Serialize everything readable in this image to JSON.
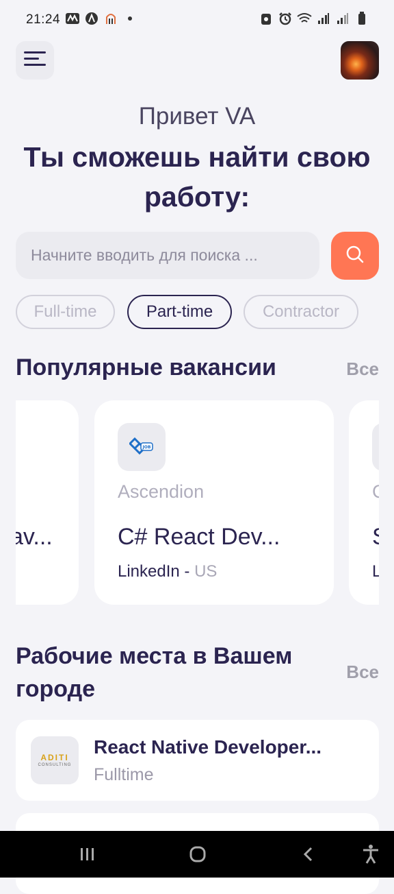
{
  "status": {
    "time": "21:24"
  },
  "header": {
    "menu_icon": "hamburger-icon",
    "avatar": "profile-avatar"
  },
  "greeting": "Привет VA",
  "headline": "Ты сможешь найти свою работу:",
  "search": {
    "placeholder": "Начните вводить для поиска ...",
    "icon": "search-icon",
    "accent": "#ff7654"
  },
  "filters": [
    {
      "label": "Full-time",
      "active": false
    },
    {
      "label": "Part-time",
      "active": true
    },
    {
      "label": "Contractor",
      "active": false
    }
  ],
  "popular": {
    "title": "Популярные вакансии",
    "see_all": "Все",
    "cards": [
      {
        "company": "",
        "title": "av...",
        "source": "",
        "location": ""
      },
      {
        "company": "Ascendion",
        "title": "C# React Dev...",
        "source": "LinkedIn - ",
        "location": "US"
      },
      {
        "company": "C",
        "title": "S",
        "source": "L",
        "location": ""
      }
    ]
  },
  "local": {
    "title": "Рабочие места в Вашем городе",
    "see_all": "Все",
    "items": [
      {
        "logo_text": "ADITI",
        "logo_sub": "CONSULTING",
        "title": "React Native Developer...",
        "type": "Fulltime"
      }
    ]
  }
}
